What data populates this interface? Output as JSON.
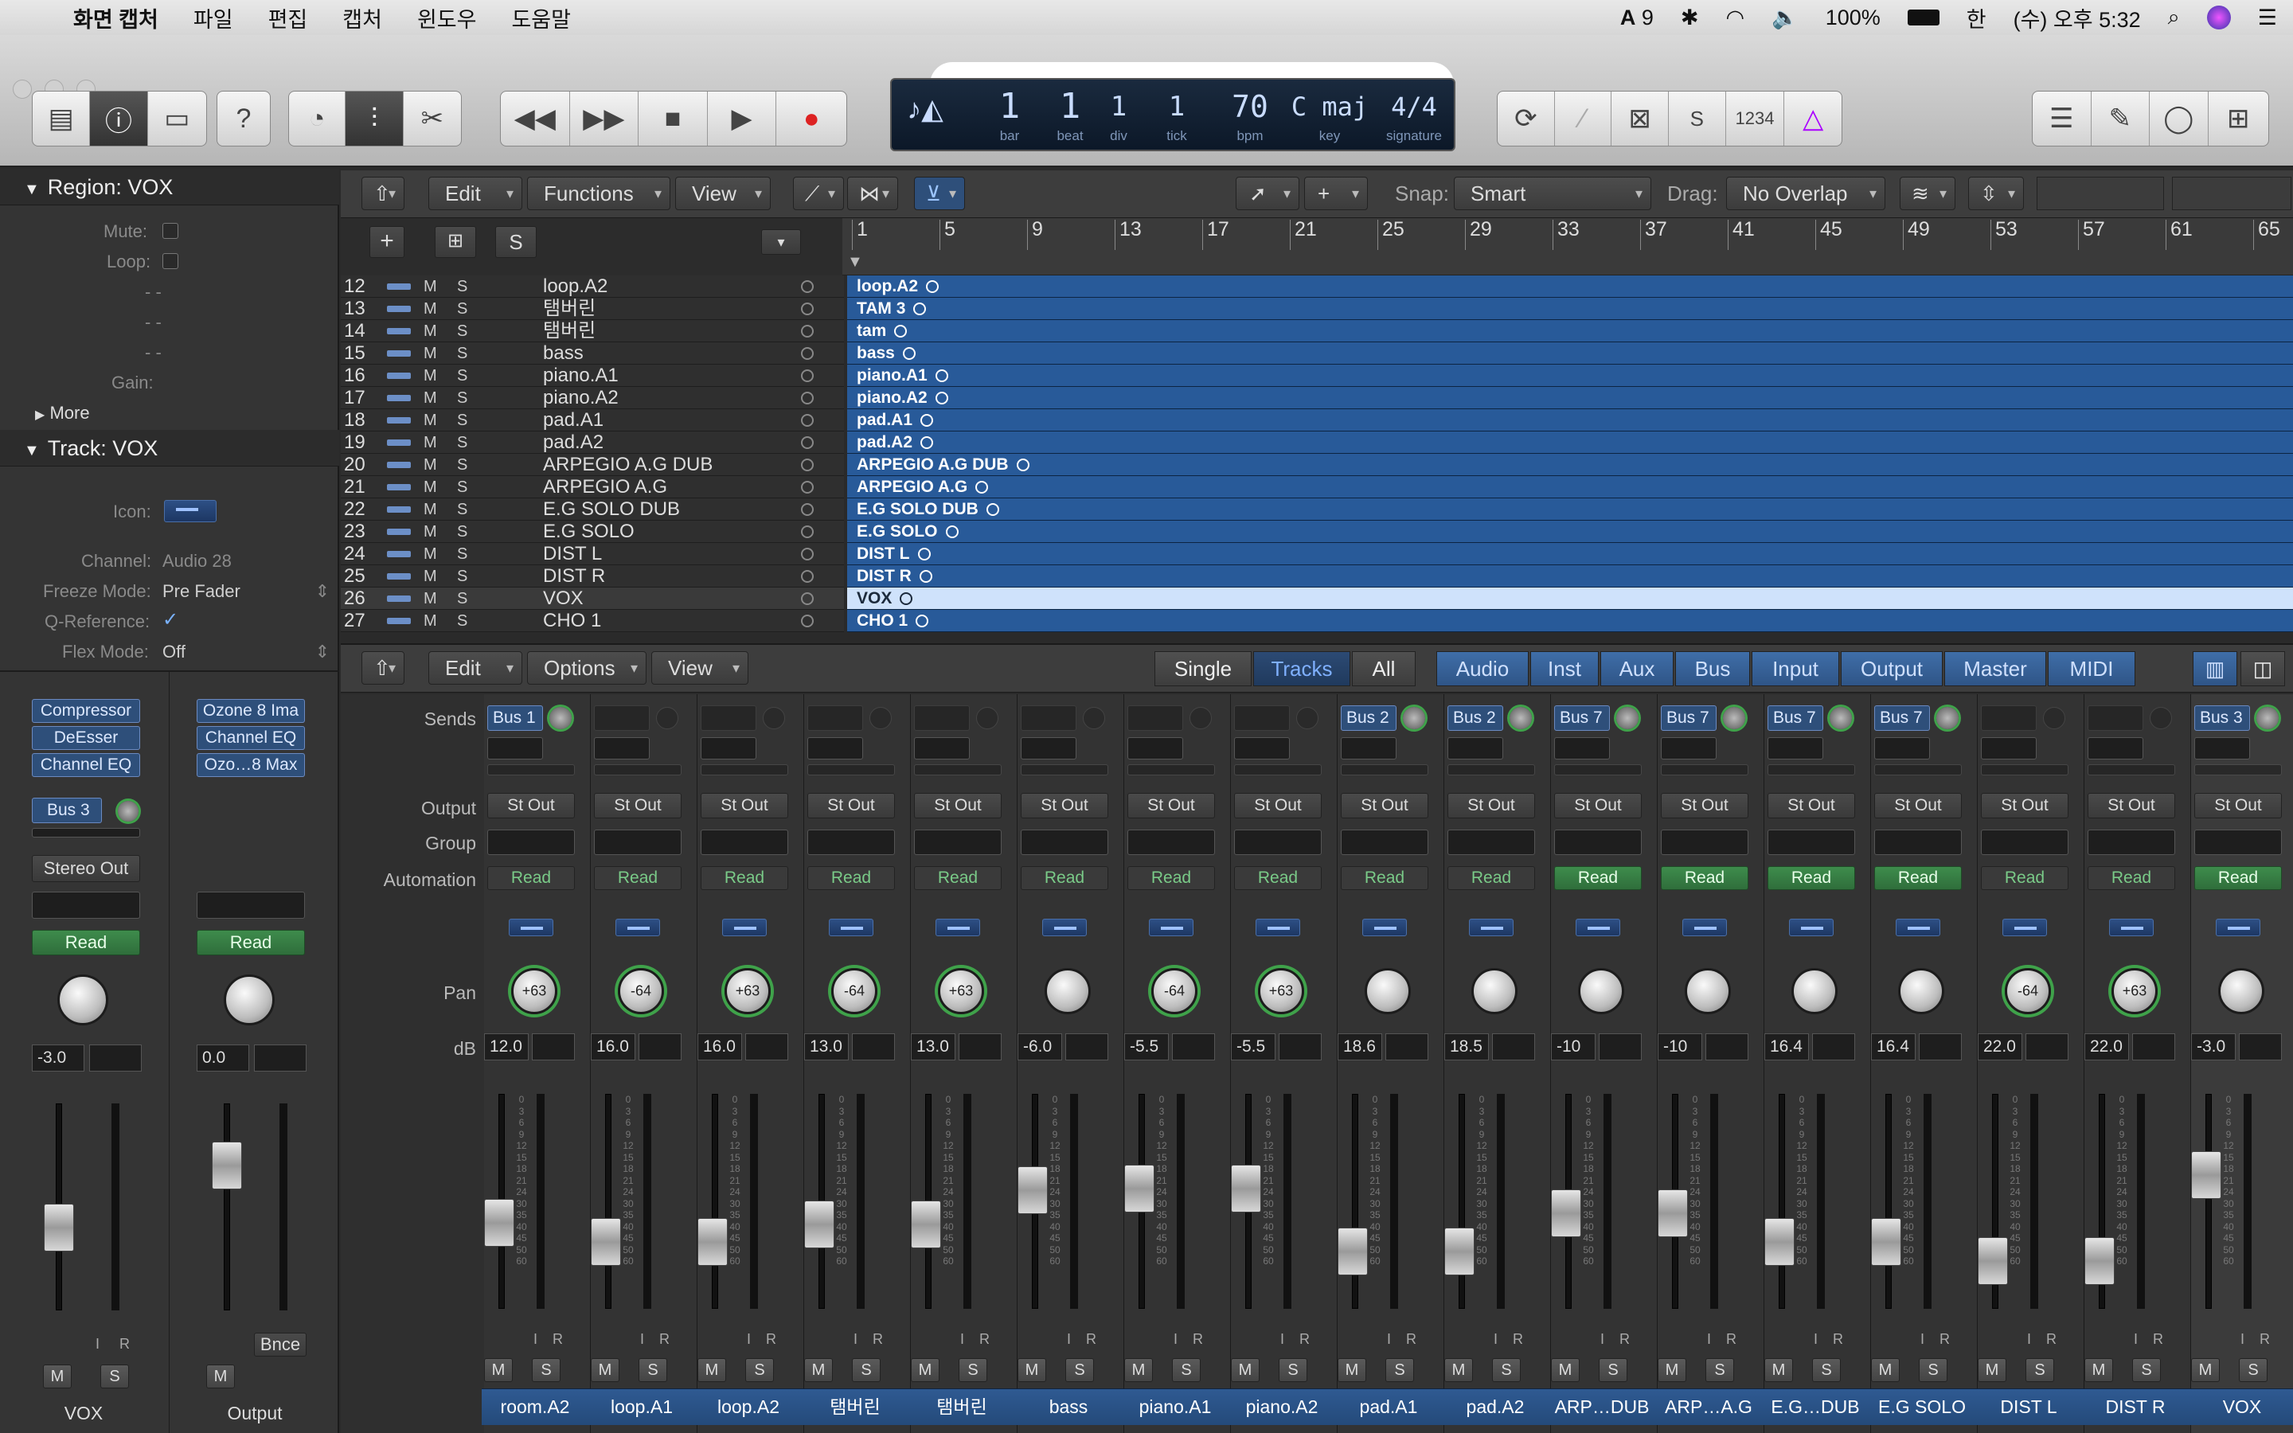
{
  "menubar": {
    "app": "화면 캡처",
    "items": [
      "파일",
      "편집",
      "캡처",
      "윈도우",
      "도움말"
    ],
    "status": {
      "adobe": "9",
      "battery": "100%",
      "input": "한",
      "clock": "(수) 오후 5:32"
    }
  },
  "lcd": {
    "bar": "1",
    "bar_label": "bar",
    "beat": "1",
    "beat_label": "beat",
    "div": "1",
    "div_label": "div",
    "tick": "1",
    "tick_label": "tick",
    "bpm": "70",
    "bpm_label": "bpm",
    "key": "C maj",
    "key_label": "key",
    "signature": "4/4",
    "signature_label": "signature",
    "counter": "1234"
  },
  "inspector": {
    "region_header": "Region: VOX",
    "mute_label": "Mute:",
    "loop_label": "Loop:",
    "dash1": "- -",
    "dash2": "- -",
    "dash3": "- -",
    "gain_label": "Gain:",
    "more_label": "More",
    "track_header": "Track: VOX",
    "icon_label": "Icon:",
    "channel_label": "Channel:",
    "channel_value": "Audio 28",
    "freeze_label": "Freeze Mode:",
    "freeze_value": "Pre Fader",
    "qref_label": "Q-Reference:",
    "flex_label": "Flex Mode:",
    "flex_value": "Off",
    "strip_left": {
      "plugins": [
        "Compressor",
        "DeEsser",
        "Channel EQ"
      ],
      "send": "Bus 3",
      "output": "Stereo Out",
      "automation": "Read",
      "db": "-3.0",
      "name": "VOX"
    },
    "strip_right": {
      "plugins": [
        "Ozone 8 Ima",
        "Channel EQ",
        "Ozo…8 Max"
      ],
      "automation": "Read",
      "db": "0.0",
      "bounce": "Bnce",
      "name": "Output"
    }
  },
  "tracks_toolbar": {
    "edit": "Edit",
    "functions": "Functions",
    "view": "View",
    "snap_label": "Snap:",
    "snap_value": "Smart",
    "drag_label": "Drag:",
    "drag_value": "No Overlap"
  },
  "track_header_buttons": {
    "solo": "S"
  },
  "ruler": [
    "1",
    "5",
    "9",
    "13",
    "17",
    "21",
    "25",
    "29",
    "33",
    "37",
    "41",
    "45",
    "49",
    "53",
    "57",
    "61",
    "65"
  ],
  "tracks": [
    {
      "num": "12",
      "name": "loop.A2",
      "region": "loop.A2"
    },
    {
      "num": "13",
      "name": "탬버린",
      "region": "TAM 3"
    },
    {
      "num": "14",
      "name": "탬버린",
      "region": "tam"
    },
    {
      "num": "15",
      "name": "bass",
      "region": "bass"
    },
    {
      "num": "16",
      "name": "piano.A1",
      "region": "piano.A1"
    },
    {
      "num": "17",
      "name": "piano.A2",
      "region": "piano.A2"
    },
    {
      "num": "18",
      "name": "pad.A1",
      "region": "pad.A1"
    },
    {
      "num": "19",
      "name": "pad.A2",
      "region": "pad.A2"
    },
    {
      "num": "20",
      "name": "ARPEGIO A.G DUB",
      "region": "ARPEGIO A.G DUB"
    },
    {
      "num": "21",
      "name": "ARPEGIO A.G",
      "region": "ARPEGIO A.G"
    },
    {
      "num": "22",
      "name": "E.G SOLO DUB",
      "region": "E.G SOLO DUB"
    },
    {
      "num": "23",
      "name": "E.G SOLO",
      "region": "E.G SOLO"
    },
    {
      "num": "24",
      "name": "DIST L",
      "region": "DIST L"
    },
    {
      "num": "25",
      "name": "DIST R",
      "region": "DIST R"
    },
    {
      "num": "26",
      "name": "VOX",
      "region": "VOX"
    },
    {
      "num": "27",
      "name": "CHO 1",
      "region": "CHO 1"
    }
  ],
  "track_buttons": {
    "mute": "M",
    "solo": "S"
  },
  "mixer_toolbar": {
    "edit": "Edit",
    "options": "Options",
    "view": "View",
    "modes": [
      "Single",
      "Tracks",
      "All"
    ],
    "filters": [
      "Audio",
      "Inst",
      "Aux",
      "Bus",
      "Input",
      "Output",
      "Master",
      "MIDI"
    ]
  },
  "mixer_labels": {
    "sends": "Sends",
    "output": "Output",
    "group": "Group",
    "automation": "Automation",
    "pan": "Pan",
    "db": "dB"
  },
  "strip_buttons": {
    "input": "I",
    "record": "R",
    "mute": "M",
    "solo": "S"
  },
  "strips": [
    {
      "name": "room.A2",
      "send": "Bus 1",
      "output": "St Out",
      "automation": "Read",
      "pan": "+63",
      "db": "12.0",
      "fader": 0.45,
      "read_active": false
    },
    {
      "name": "loop.A1",
      "send": "",
      "output": "St Out",
      "automation": "Read",
      "pan": "-64",
      "db": "16.0",
      "fader": 0.35,
      "read_active": false
    },
    {
      "name": "loop.A2",
      "send": "",
      "output": "St Out",
      "automation": "Read",
      "pan": "+63",
      "db": "16.0",
      "fader": 0.35,
      "read_active": false
    },
    {
      "name": "탬버린",
      "send": "",
      "output": "St Out",
      "automation": "Read",
      "pan": "-64",
      "db": "13.0",
      "fader": 0.44,
      "read_active": false
    },
    {
      "name": "탬버린",
      "send": "",
      "output": "St Out",
      "automation": "Read",
      "pan": "+63",
      "db": "13.0",
      "fader": 0.44,
      "read_active": false
    },
    {
      "name": "bass",
      "send": "",
      "output": "St Out",
      "automation": "Read",
      "pan": "",
      "db": "-6.0",
      "fader": 0.62,
      "read_active": false
    },
    {
      "name": "piano.A1",
      "send": "",
      "output": "St Out",
      "automation": "Read",
      "pan": "-64",
      "db": "-5.5",
      "fader": 0.63,
      "read_active": false
    },
    {
      "name": "piano.A2",
      "send": "",
      "output": "St Out",
      "automation": "Read",
      "pan": "+63",
      "db": "-5.5",
      "fader": 0.63,
      "read_active": false
    },
    {
      "name": "pad.A1",
      "send": "Bus 2",
      "output": "St Out",
      "automation": "Read",
      "pan": "",
      "db": "18.6",
      "fader": 0.3,
      "read_active": false
    },
    {
      "name": "pad.A2",
      "send": "Bus 2",
      "output": "St Out",
      "automation": "Read",
      "pan": "",
      "db": "18.5",
      "fader": 0.3,
      "read_active": false
    },
    {
      "name": "ARP…DUB",
      "send": "Bus 7",
      "output": "St Out",
      "automation": "Read",
      "pan": "",
      "db": "-10",
      "fader": 0.5,
      "read_active": true
    },
    {
      "name": "ARP…A.G",
      "send": "Bus 7",
      "output": "St Out",
      "automation": "Read",
      "pan": "",
      "db": "-10",
      "fader": 0.5,
      "read_active": true
    },
    {
      "name": "E.G…DUB",
      "send": "Bus 7",
      "output": "St Out",
      "automation": "Read",
      "pan": "",
      "db": "16.4",
      "fader": 0.35,
      "read_active": true
    },
    {
      "name": "E.G SOLO",
      "send": "Bus 7",
      "output": "St Out",
      "automation": "Read",
      "pan": "",
      "db": "16.4",
      "fader": 0.35,
      "read_active": true
    },
    {
      "name": "DIST L",
      "send": "",
      "output": "St Out",
      "automation": "Read",
      "pan": "-64",
      "db": "22.0",
      "fader": 0.25,
      "read_active": false
    },
    {
      "name": "DIST R",
      "send": "",
      "output": "St Out",
      "automation": "Read",
      "pan": "+63",
      "db": "22.0",
      "fader": 0.25,
      "read_active": false
    },
    {
      "name": "VOX",
      "send": "Bus 3",
      "output": "St Out",
      "automation": "Read",
      "pan": "",
      "db": "-3.0",
      "fader": 0.7,
      "read_active": true
    }
  ],
  "fader_scale": [
    "0",
    "3",
    "6",
    "9",
    "12",
    "15",
    "18",
    "21",
    "24",
    "30",
    "35",
    "40",
    "45",
    "50",
    "60"
  ],
  "colors": {
    "region": "#285a99",
    "region_selected": "#cfe2fb",
    "read_green": "#3e8c4c",
    "send_blue": "#2e4f7a",
    "strip_name_blue": "#2f5a92"
  }
}
